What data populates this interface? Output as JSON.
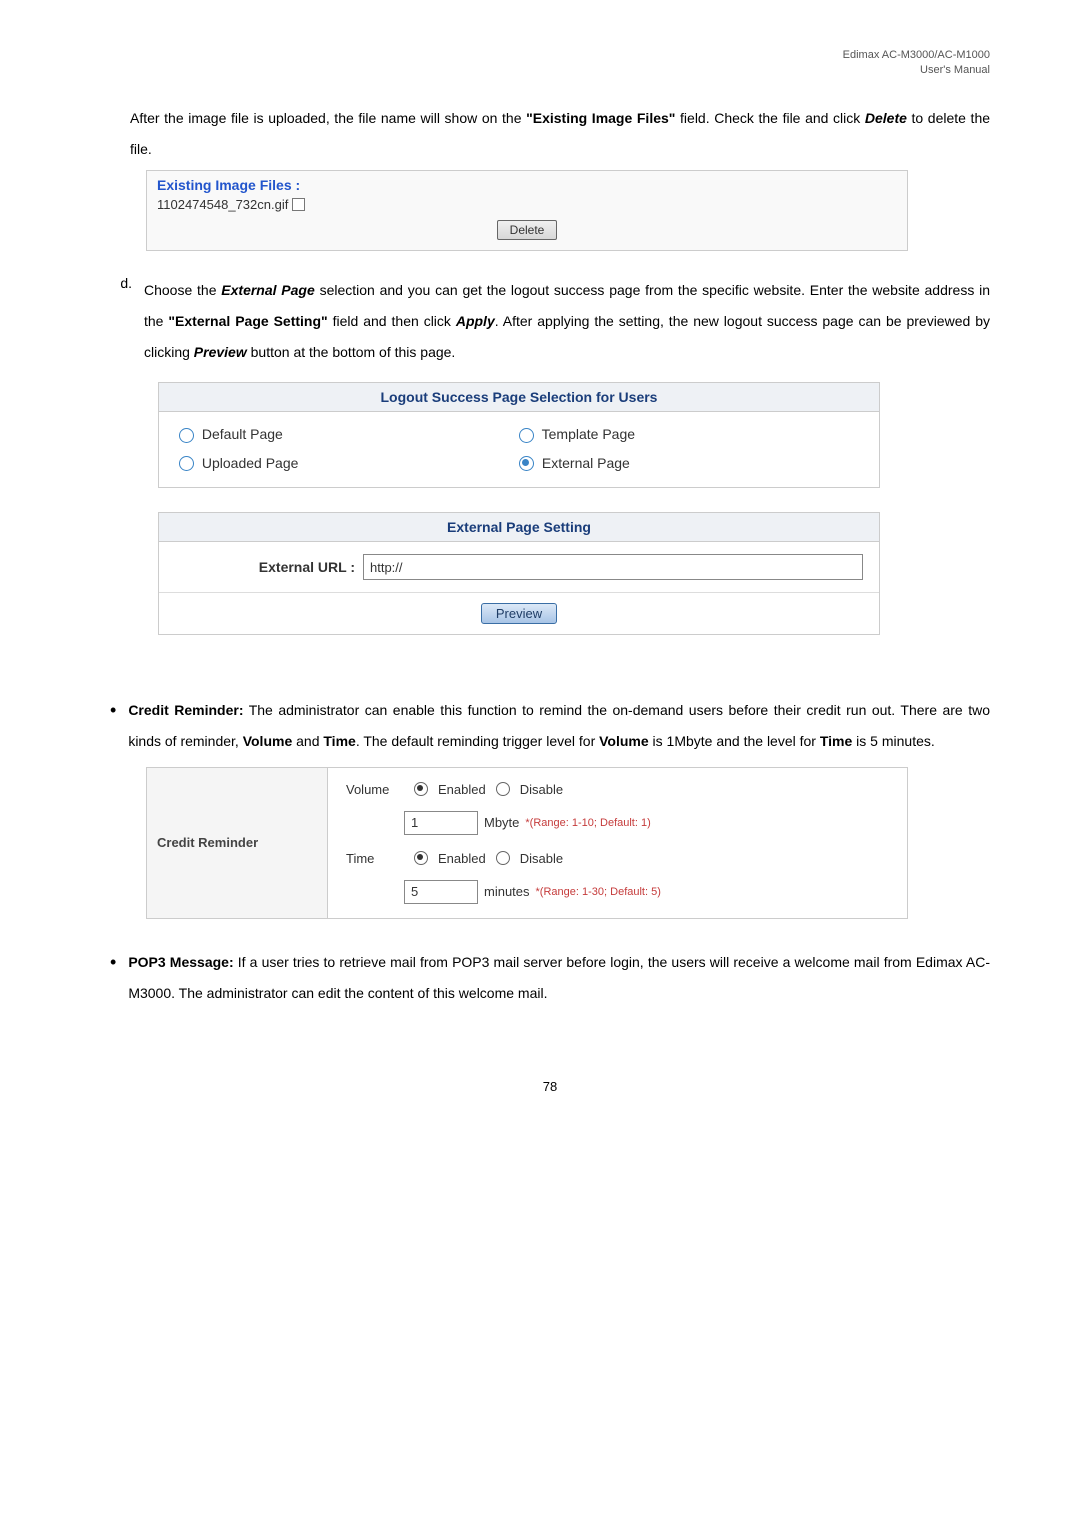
{
  "header": {
    "line1": "Edimax  AC-M3000/AC-M1000",
    "line2": "User's  Manual"
  },
  "intro": {
    "t1": "After the image file is uploaded, the file name will show on the ",
    "t2": "\"Existing Image Files\"",
    "t3": " field. Check the file and click ",
    "t4": "Delete",
    "t5": " to delete the file."
  },
  "embed1": {
    "title": "Existing Image Files :",
    "filename": "1102474548_732cn.gif",
    "delete": "Delete"
  },
  "letterD": {
    "marker": "d.",
    "t1": "Choose the ",
    "t2": "External Page",
    "t3": " selection and you can get the logout success page from the specific website. Enter the website address in the ",
    "t4": "\"External Page Setting\"",
    "t5": " field and then click ",
    "t6": "Apply",
    "t7": ". After applying the setting, the new logout success page can be previewed by clicking ",
    "t8": "Preview",
    "t9": " button at the bottom of this page."
  },
  "panel1": {
    "title": "Logout Success Page Selection for Users",
    "opt1": " Default Page",
    "opt2": " Template Page",
    "opt3": " Uploaded Page",
    "opt4": " External Page"
  },
  "panel2": {
    "title": "External Page Setting",
    "label": "External URL :",
    "value": "http://",
    "preview": "Preview"
  },
  "credit": {
    "t1": "Credit Reminder:",
    "t2": " The administrator can enable this function to remind the on-demand users before their credit run out. There are two kinds of reminder, ",
    "t3": "Volume",
    "t4": " and ",
    "t5": "Time",
    "t6": ". The default reminding trigger level for ",
    "t7": "Volume",
    "t8": " is 1Mbyte and the level for ",
    "t9": "Time",
    "t10": " is 5 minutes."
  },
  "embed3": {
    "left": "Credit Reminder",
    "volume": "Volume",
    "time": "Time",
    "enabled": " Enabled ",
    "disable": " Disable",
    "val1": "1",
    "unit1": "Mbyte",
    "hint1": "*(Range: 1-10; Default: 1)",
    "val2": "5",
    "unit2": "minutes",
    "hint2": "*(Range: 1-30; Default: 5)"
  },
  "pop3": {
    "t1": "POP3 Message:",
    "t2": " If a user tries to retrieve mail from POP3 mail server before login, the users will receive a welcome mail from Edimax AC-M3000. The administrator can edit the content of this welcome mail."
  },
  "pagenum": "78"
}
